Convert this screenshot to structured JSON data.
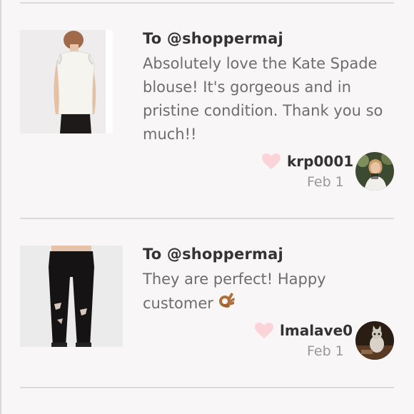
{
  "comments": [
    {
      "to": "To @shoppermaj",
      "message": "Absolutely love the Kate Spade blouse! It's gorgeous and in pristine condition. Thank you so much!!",
      "username": "krp0001",
      "date": "Feb 1",
      "thumbnail_icon": "white-blouse-photo",
      "avatar_icon": "user-avatar-photo"
    },
    {
      "to": "To @shoppermaj",
      "message": "They are perfect! Happy customer",
      "emoji": "ok-hand-emoji",
      "username": "lmalave0",
      "date": "Feb 1",
      "thumbnail_icon": "black-jeans-photo",
      "avatar_icon": "cat-avatar-photo"
    }
  ],
  "colors": {
    "heart": "#fbd4d9",
    "background": "#f8f6f7",
    "divider": "#dcdadb"
  }
}
